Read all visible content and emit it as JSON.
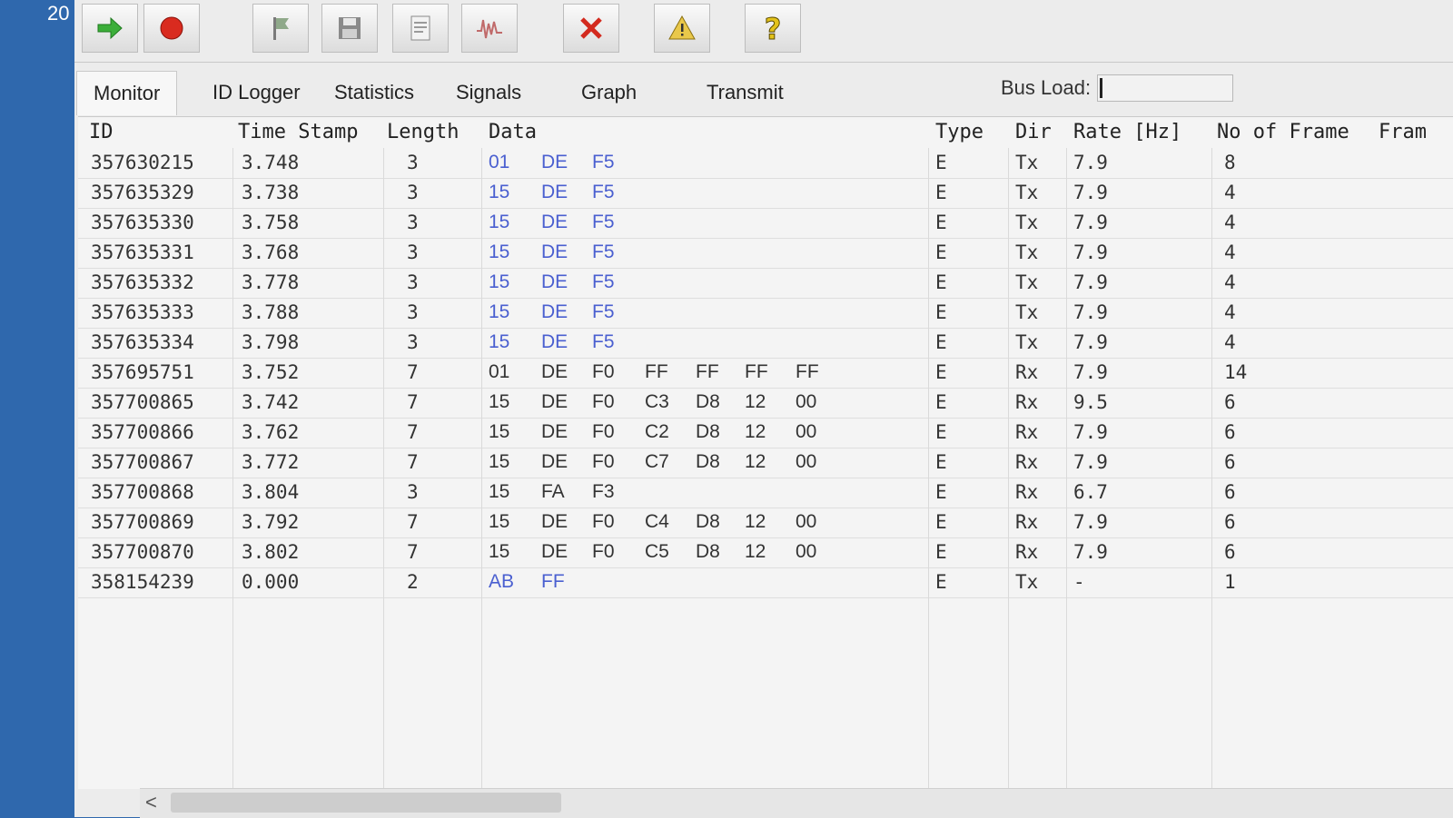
{
  "corner_text": "20",
  "toolbar": {
    "buttons": [
      {
        "name": "start",
        "icon": "green-arrow-right-icon"
      },
      {
        "name": "stop",
        "icon": "red-circle-icon"
      },
      {
        "name": "filter",
        "icon": "flag-icon"
      },
      {
        "name": "save",
        "icon": "floppy-disk-icon"
      },
      {
        "name": "export",
        "icon": "document-icon"
      },
      {
        "name": "signal",
        "icon": "waveform-icon"
      },
      {
        "name": "delete",
        "icon": "red-x-icon"
      },
      {
        "name": "warning",
        "icon": "warning-triangle-icon"
      },
      {
        "name": "help",
        "icon": "question-mark-icon"
      }
    ]
  },
  "tabs": [
    "Monitor",
    "ID Logger",
    "Statistics",
    "Signals",
    "Graph",
    "Transmit"
  ],
  "active_tab": "Monitor",
  "bus_load": {
    "label": "Bus Load:"
  },
  "columns": [
    "ID",
    "Time Stamp",
    "Length",
    "Data",
    "Type",
    "Dir",
    "Rate [Hz]",
    "No of Frame",
    "Fram"
  ],
  "rows": [
    {
      "id": "357630215",
      "ts": "3.748",
      "len": "3",
      "data": [
        "01",
        "DE",
        "F5"
      ],
      "type": "E",
      "dir": "Tx",
      "rate": "7.9",
      "frames": "8"
    },
    {
      "id": "357635329",
      "ts": "3.738",
      "len": "3",
      "data": [
        "15",
        "DE",
        "F5"
      ],
      "type": "E",
      "dir": "Tx",
      "rate": "7.9",
      "frames": "4"
    },
    {
      "id": "357635330",
      "ts": "3.758",
      "len": "3",
      "data": [
        "15",
        "DE",
        "F5"
      ],
      "type": "E",
      "dir": "Tx",
      "rate": "7.9",
      "frames": "4"
    },
    {
      "id": "357635331",
      "ts": "3.768",
      "len": "3",
      "data": [
        "15",
        "DE",
        "F5"
      ],
      "type": "E",
      "dir": "Tx",
      "rate": "7.9",
      "frames": "4"
    },
    {
      "id": "357635332",
      "ts": "3.778",
      "len": "3",
      "data": [
        "15",
        "DE",
        "F5"
      ],
      "type": "E",
      "dir": "Tx",
      "rate": "7.9",
      "frames": "4"
    },
    {
      "id": "357635333",
      "ts": "3.788",
      "len": "3",
      "data": [
        "15",
        "DE",
        "F5"
      ],
      "type": "E",
      "dir": "Tx",
      "rate": "7.9",
      "frames": "4"
    },
    {
      "id": "357635334",
      "ts": "3.798",
      "len": "3",
      "data": [
        "15",
        "DE",
        "F5"
      ],
      "type": "E",
      "dir": "Tx",
      "rate": "7.9",
      "frames": "4"
    },
    {
      "id": "357695751",
      "ts": "3.752",
      "len": "7",
      "data": [
        "01",
        "DE",
        "F0",
        "FF",
        "FF",
        "FF",
        "FF"
      ],
      "type": "E",
      "dir": "Rx",
      "rate": "7.9",
      "frames": "14"
    },
    {
      "id": "357700865",
      "ts": "3.742",
      "len": "7",
      "data": [
        "15",
        "DE",
        "F0",
        "C3",
        "D8",
        "12",
        "00"
      ],
      "type": "E",
      "dir": "Rx",
      "rate": "9.5",
      "frames": "6"
    },
    {
      "id": "357700866",
      "ts": "3.762",
      "len": "7",
      "data": [
        "15",
        "DE",
        "F0",
        "C2",
        "D8",
        "12",
        "00"
      ],
      "type": "E",
      "dir": "Rx",
      "rate": "7.9",
      "frames": "6"
    },
    {
      "id": "357700867",
      "ts": "3.772",
      "len": "7",
      "data": [
        "15",
        "DE",
        "F0",
        "C7",
        "D8",
        "12",
        "00"
      ],
      "type": "E",
      "dir": "Rx",
      "rate": "7.9",
      "frames": "6"
    },
    {
      "id": "357700868",
      "ts": "3.804",
      "len": "3",
      "data": [
        "15",
        "FA",
        "F3"
      ],
      "type": "E",
      "dir": "Rx",
      "rate": "6.7",
      "frames": "6"
    },
    {
      "id": "357700869",
      "ts": "3.792",
      "len": "7",
      "data": [
        "15",
        "DE",
        "F0",
        "C4",
        "D8",
        "12",
        "00"
      ],
      "type": "E",
      "dir": "Rx",
      "rate": "7.9",
      "frames": "6"
    },
    {
      "id": "357700870",
      "ts": "3.802",
      "len": "7",
      "data": [
        "15",
        "DE",
        "F0",
        "C5",
        "D8",
        "12",
        "00"
      ],
      "type": "E",
      "dir": "Rx",
      "rate": "7.9",
      "frames": "6"
    },
    {
      "id": "358154239",
      "ts": "0.000",
      "len": "2",
      "data": [
        "AB",
        "FF"
      ],
      "type": "E",
      "dir": "Tx",
      "rate": "-",
      "frames": "1"
    }
  ],
  "scrollbar": {
    "left_arrow": "<"
  }
}
